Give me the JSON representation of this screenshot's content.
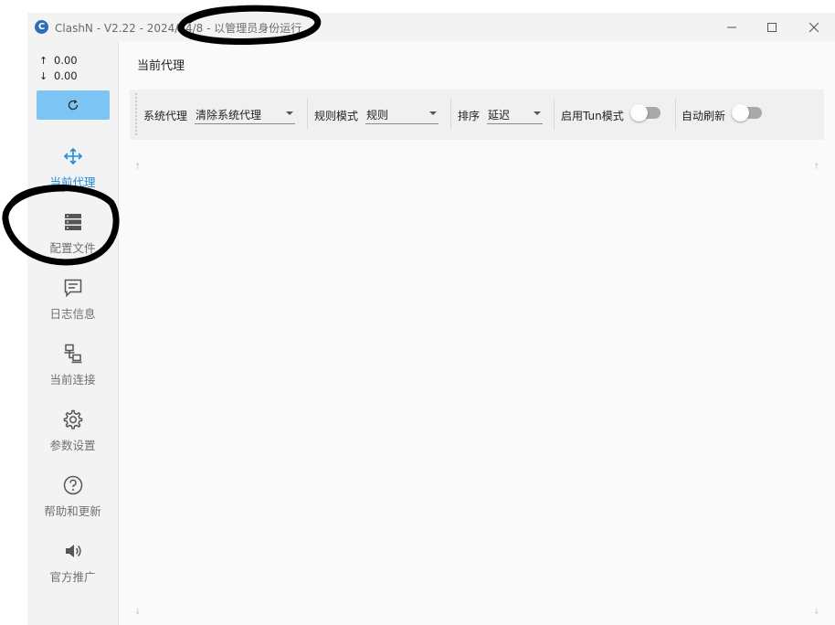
{
  "window": {
    "logo": "C",
    "title": "ClashN - V2.22 - 2024/04/",
    "title_overlay_digit": "8",
    "title_suffix": " - 以管理员身份运行",
    "icons": {
      "minimize": "minimize-icon",
      "maximize": "maximize-icon",
      "close": "close-icon"
    }
  },
  "sidebar": {
    "upload_arrow": "↑",
    "upload_speed": "0.00",
    "download_arrow": "↓",
    "download_speed": "0.00",
    "refresh_icon": "refresh-icon",
    "items": [
      {
        "label": "当前代理",
        "icon": "move-arrows-icon",
        "active": true
      },
      {
        "label": "配置文件",
        "icon": "server-stack-icon",
        "active": false
      },
      {
        "label": "日志信息",
        "icon": "message-icon",
        "active": false
      },
      {
        "label": "当前连接",
        "icon": "network-icon",
        "active": false
      },
      {
        "label": "参数设置",
        "icon": "gear-icon",
        "active": false
      },
      {
        "label": "帮助和更新",
        "icon": "help-circle-icon",
        "active": false
      },
      {
        "label": "官方推广",
        "icon": "speaker-icon",
        "active": false
      }
    ]
  },
  "main": {
    "title": "当前代理",
    "toolbar": {
      "system_proxy_label": "系统代理",
      "system_proxy_value": "清除系统代理",
      "rule_mode_label": "规则模式",
      "rule_mode_value": "规则",
      "sort_label": "排序",
      "sort_value": "延迟",
      "tun_label": "启用Tun模式",
      "tun_enabled": false,
      "auto_refresh_label": "自动刷新",
      "auto_refresh_enabled": false
    },
    "scroll_up": "↑",
    "scroll_down": "↓"
  },
  "colors": {
    "accent": "#1f8ddc",
    "refresh_button": "#7cc4f4",
    "sidebar_bg": "#f3f3f3",
    "content_bg": "#fafafa",
    "toolbar_bg": "#f0f0f0"
  }
}
